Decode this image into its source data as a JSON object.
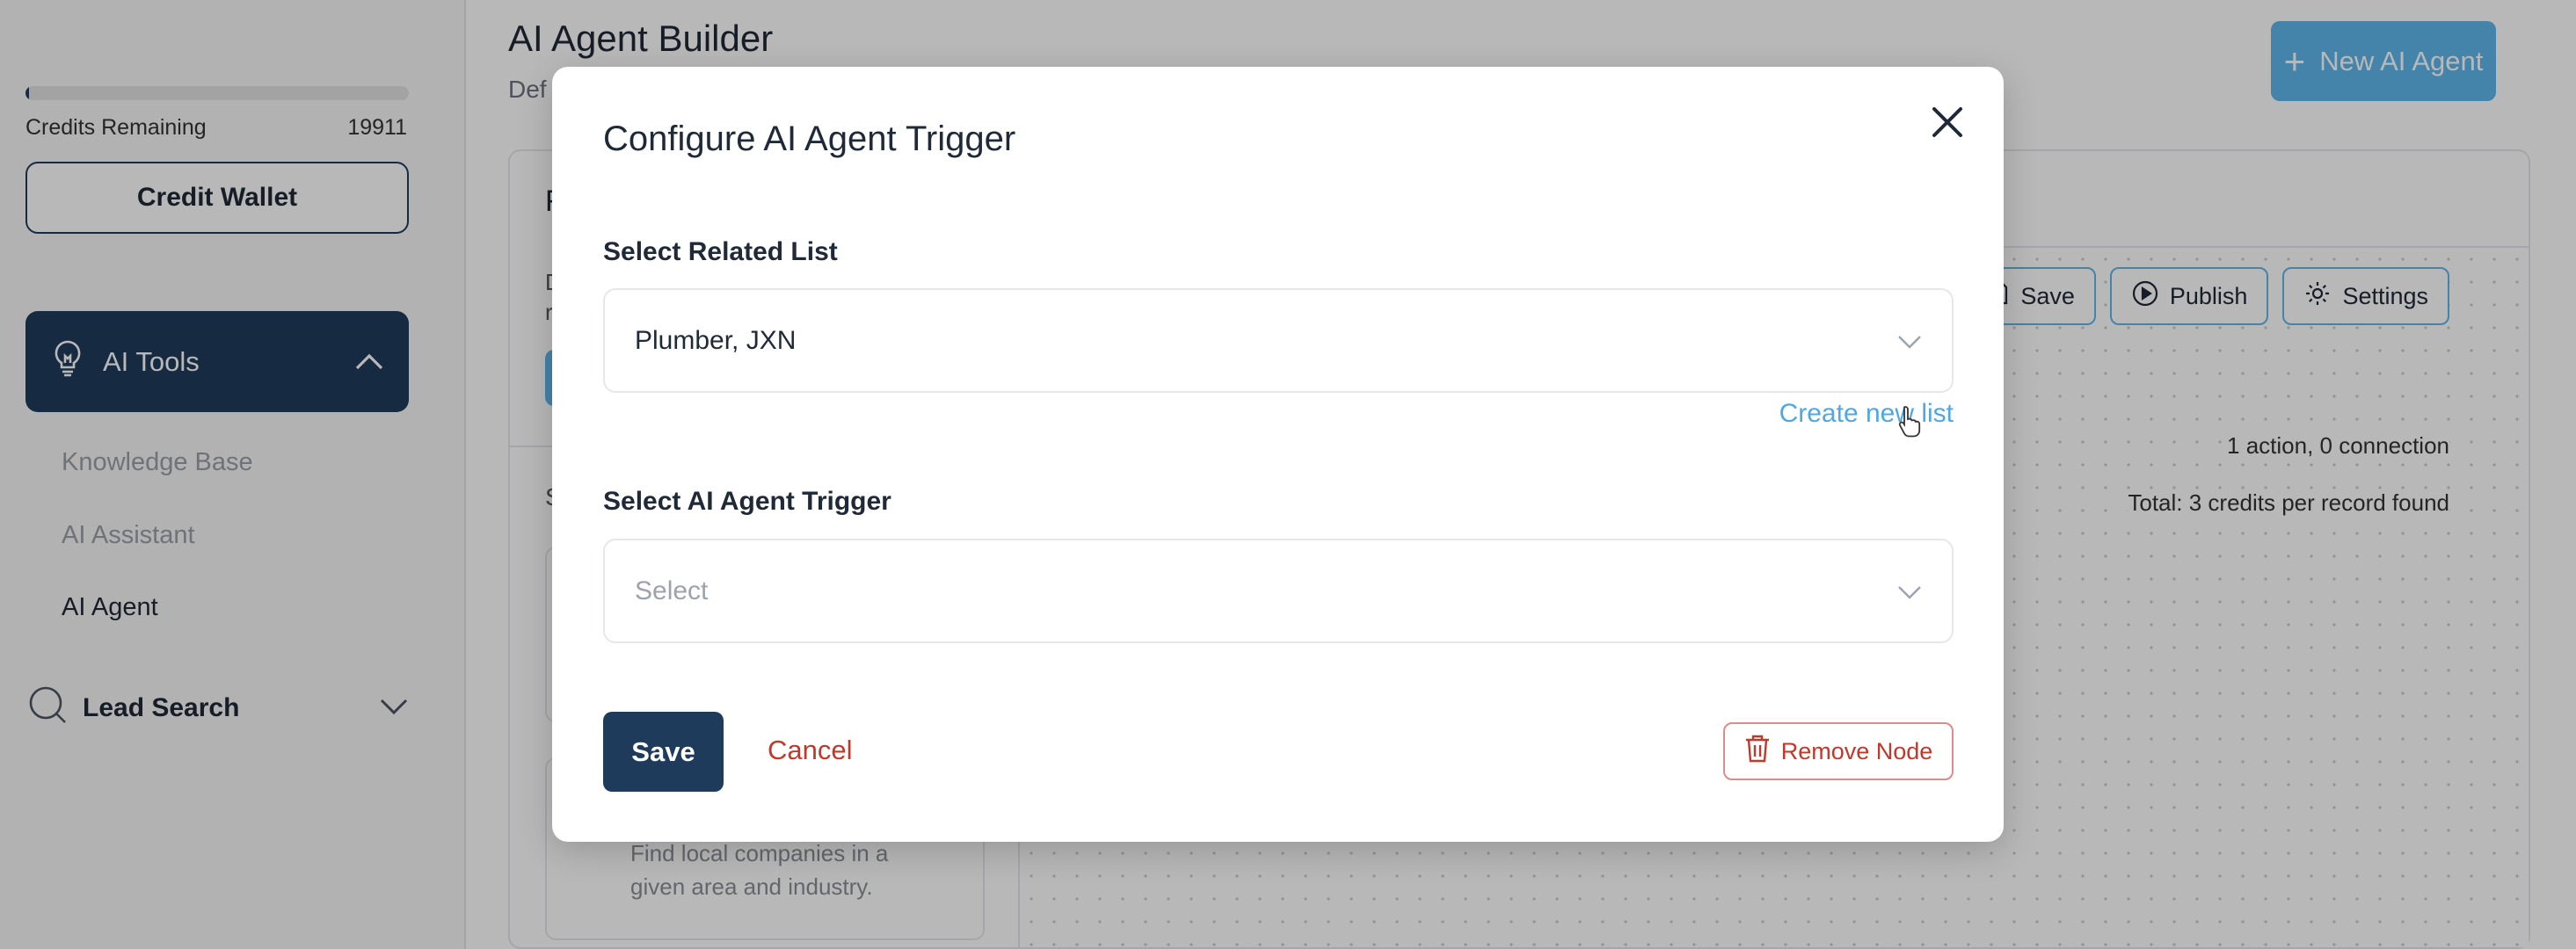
{
  "sidebar": {
    "credits_label": "Credits Remaining",
    "credits_value": "19911",
    "credits_fraction": 0.01,
    "credit_wallet_label": "Credit Wallet",
    "ai_tools_label": "AI Tools",
    "ai_tools_items": [
      "Knowledge Base",
      "AI Assistant",
      "AI Agent"
    ],
    "active_item": "AI Agent",
    "lead_search_label": "Lead Search"
  },
  "main": {
    "title": "AI Agent Builder",
    "subtitle": "Def",
    "new_agent_label": "New AI Agent",
    "palette_letter": "F",
    "palette_desc": "D\nr",
    "palette_section_letter": "S",
    "palette_card_desc": "Find local companies in a given area and industry.",
    "toolbar": {
      "save": "Save",
      "publish": "Publish",
      "settings": "Settings"
    },
    "canvas_info": [
      "1 action, 0 connection",
      "Total: 3 credits per record found"
    ]
  },
  "modal": {
    "title": "Configure AI Agent Trigger",
    "related_list_label": "Select Related List",
    "related_list_value": "Plumber, JXN",
    "create_new_list": "Create new list",
    "trigger_label": "Select AI Agent Trigger",
    "trigger_placeholder": "Select",
    "save_label": "Save",
    "cancel_label": "Cancel",
    "remove_label": "Remove Node"
  },
  "colors": {
    "primary": "#1f3b5c",
    "accent": "#5fb6ec",
    "link": "#4ea8e6",
    "danger": "#c0392b"
  }
}
